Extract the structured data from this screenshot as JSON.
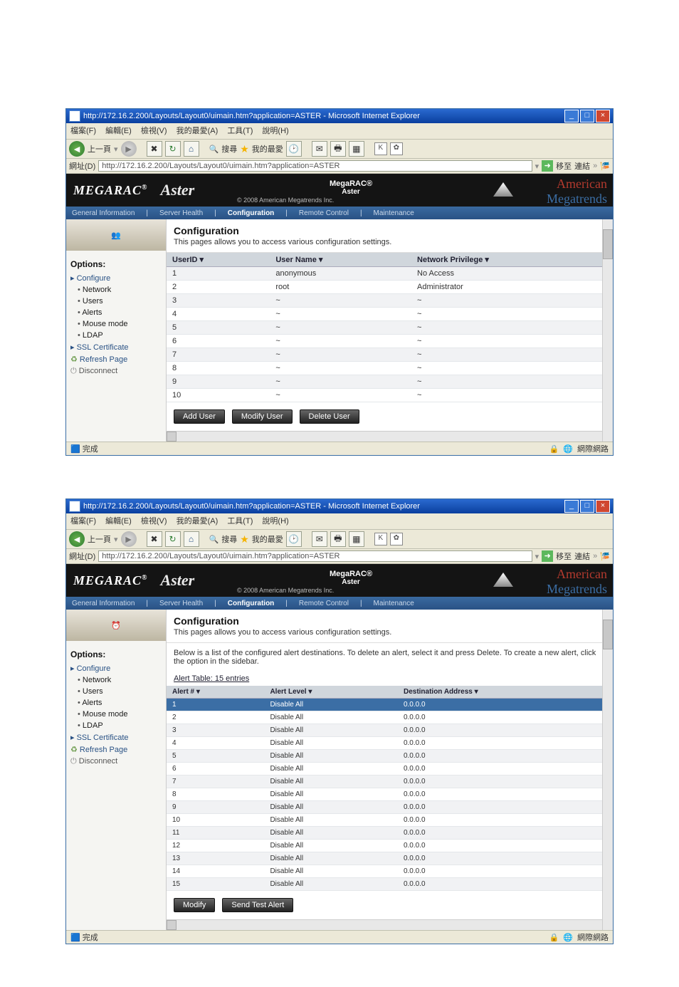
{
  "shot1": {
    "window_title": "http://172.16.2.200/Layouts/Layout0/uimain.htm?application=ASTER - Microsoft Internet Explorer",
    "menu": [
      "檔案(F)",
      "編輯(E)",
      "檢視(V)",
      "我的最愛(A)",
      "工具(T)",
      "說明(H)"
    ],
    "toolbar": {
      "back": "上一頁",
      "search": "搜尋",
      "fav": "我的最愛"
    },
    "addr_label": "網址(D)",
    "url": "http://172.16.2.200/Layouts/Layout0/uimain.htm?application=ASTER",
    "go": "移至",
    "links": "連結",
    "brand": {
      "logo": "MEGARAC",
      "reg": "®",
      "aster": "Aster",
      "sub": "© 2008 American Megatrends Inc.",
      "center1": "MegaRAC®",
      "center2": "Aster",
      "ami1": "American",
      "ami2": "Megatrends"
    },
    "tabs": [
      "General Information",
      "Server Health",
      "Configuration",
      "Remote Control",
      "Maintenance"
    ],
    "section": {
      "title": "Configuration",
      "desc": "This pages allows you to access various configuration settings."
    },
    "options_title": "Options:",
    "side": {
      "configure": "Configure",
      "items": [
        "Network",
        "Users",
        "Alerts",
        "Mouse mode",
        "LDAP"
      ],
      "ssl": "SSL Certificate",
      "refresh": "Refresh Page",
      "disconnect": "Disconnect"
    },
    "table": {
      "headers": [
        "UserID ▾",
        "User Name ▾",
        "Network Privilege ▾"
      ],
      "rows": [
        [
          "1",
          "anonymous",
          "No Access"
        ],
        [
          "2",
          "root",
          "Administrator"
        ],
        [
          "3",
          "~",
          "~"
        ],
        [
          "4",
          "~",
          "~"
        ],
        [
          "5",
          "~",
          "~"
        ],
        [
          "6",
          "~",
          "~"
        ],
        [
          "7",
          "~",
          "~"
        ],
        [
          "8",
          "~",
          "~"
        ],
        [
          "9",
          "~",
          "~"
        ],
        [
          "10",
          "~",
          "~"
        ]
      ]
    },
    "buttons": [
      "Add User",
      "Modify User",
      "Delete User"
    ],
    "status": {
      "left": "完成",
      "right": "網際網路"
    }
  },
  "shot2": {
    "window_title": "http://172.16.2.200/Layouts/Layout0/uimain.htm?application=ASTER - Microsoft Internet Explorer",
    "menu": [
      "檔案(F)",
      "編輯(E)",
      "檢視(V)",
      "我的最愛(A)",
      "工具(T)",
      "說明(H)"
    ],
    "toolbar": {
      "back": "上一頁",
      "search": "搜尋",
      "fav": "我的最愛"
    },
    "addr_label": "網址(D)",
    "url": "http://172.16.2.200/Layouts/Layout0/uimain.htm?application=ASTER",
    "go": "移至",
    "links": "連結",
    "brand": {
      "logo": "MEGARAC",
      "reg": "®",
      "aster": "Aster",
      "sub": "© 2008 American Megatrends Inc.",
      "center1": "MegaRAC®",
      "center2": "Aster",
      "ami1": "American",
      "ami2": "Megatrends"
    },
    "tabs": [
      "General Information",
      "Server Health",
      "Configuration",
      "Remote Control",
      "Maintenance"
    ],
    "section": {
      "title": "Configuration",
      "desc": "This pages allows you to access various configuration settings."
    },
    "intro": "Below is a list of the configured alert destinations. To delete an alert, select it and press Delete. To create a new alert, click the option in the sidebar.",
    "caption": "Alert Table: 15 entries",
    "options_title": "Options:",
    "side": {
      "configure": "Configure",
      "items": [
        "Network",
        "Users",
        "Alerts",
        "Mouse mode",
        "LDAP"
      ],
      "ssl": "SSL Certificate",
      "refresh": "Refresh Page",
      "disconnect": "Disconnect"
    },
    "table": {
      "headers": [
        "Alert # ▾",
        "Alert Level ▾",
        "Destination Address ▾"
      ],
      "rows": [
        [
          "1",
          "Disable All",
          "0.0.0.0"
        ],
        [
          "2",
          "Disable All",
          "0.0.0.0"
        ],
        [
          "3",
          "Disable All",
          "0.0.0.0"
        ],
        [
          "4",
          "Disable All",
          "0.0.0.0"
        ],
        [
          "5",
          "Disable All",
          "0.0.0.0"
        ],
        [
          "6",
          "Disable All",
          "0.0.0.0"
        ],
        [
          "7",
          "Disable All",
          "0.0.0.0"
        ],
        [
          "8",
          "Disable All",
          "0.0.0.0"
        ],
        [
          "9",
          "Disable All",
          "0.0.0.0"
        ],
        [
          "10",
          "Disable All",
          "0.0.0.0"
        ],
        [
          "11",
          "Disable All",
          "0.0.0.0"
        ],
        [
          "12",
          "Disable All",
          "0.0.0.0"
        ],
        [
          "13",
          "Disable All",
          "0.0.0.0"
        ],
        [
          "14",
          "Disable All",
          "0.0.0.0"
        ],
        [
          "15",
          "Disable All",
          "0.0.0.0"
        ]
      ]
    },
    "buttons": [
      "Modify",
      "Send Test Alert"
    ],
    "status": {
      "left": "完成",
      "right": "網際網路"
    }
  }
}
